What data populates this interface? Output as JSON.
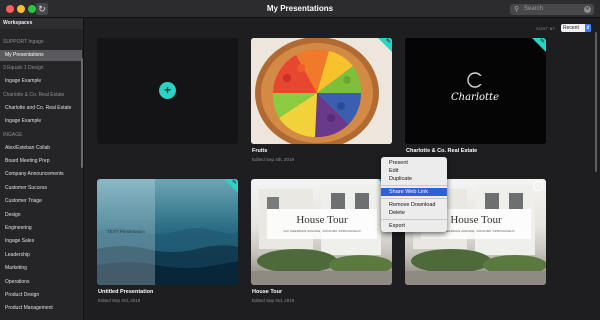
{
  "window": {
    "title": "My Presentations"
  },
  "search": {
    "placeholder": "Search"
  },
  "sidebar": {
    "header": "Workspaces",
    "rows": [
      {
        "type": "section",
        "label": "SUPPORT Ingage"
      },
      {
        "type": "item",
        "label": "My Presentations",
        "selected": true
      },
      {
        "type": "section",
        "label": "3 Equals 1 Design"
      },
      {
        "type": "item",
        "label": "Ingage Example"
      },
      {
        "type": "section",
        "label": "Charlotte & Co. Real Estate"
      },
      {
        "type": "item",
        "label": "Charlotte and Co. Real Estate"
      },
      {
        "type": "item",
        "label": "Ingage Example"
      },
      {
        "type": "section",
        "label": "INGAGE"
      },
      {
        "type": "item",
        "label": "Alex/Esteban Collab"
      },
      {
        "type": "item",
        "label": "Board Meeting Prep"
      },
      {
        "type": "item",
        "label": "Company Announcements"
      },
      {
        "type": "item",
        "label": "Customer Success"
      },
      {
        "type": "item",
        "label": "Customer Triage"
      },
      {
        "type": "item",
        "label": "Design"
      },
      {
        "type": "item",
        "label": "Engineering"
      },
      {
        "type": "item",
        "label": "Ingage Sales"
      },
      {
        "type": "item",
        "label": "Leadership"
      },
      {
        "type": "item",
        "label": "Marketing"
      },
      {
        "type": "item",
        "label": "Operations"
      },
      {
        "type": "item",
        "label": "Product Design"
      },
      {
        "type": "item",
        "label": "Product Management"
      }
    ]
  },
  "toolbar": {
    "sort_label": "SORT BY",
    "sort_value": "Recent"
  },
  "cards": {
    "new": {
      "add_icon": "plus-icon"
    },
    "fruits": {
      "title": "Fruits",
      "subtitle": "Edited Sep 4th, 2019"
    },
    "charlotte": {
      "title": "Charlotte & Co. Real Estate",
      "subtitle": "",
      "logo_letter": "C",
      "logo_text": "Charlotte"
    },
    "untitled": {
      "title": "Untitled Presentation",
      "subtitle": "Edited Sep 3rd, 2019",
      "thumb_text": "TEXT Presentation"
    },
    "housetour": {
      "title": "House Tour",
      "subtitle": "Edited Sep 3rd, 2019",
      "thumb_title": "House Tour",
      "thumb_sub": "123 SHERMAN AVENUE, DUNKIRK SPRINGFIELD"
    },
    "housetour2": {
      "thumb_title": "House Tour",
      "thumb_sub": "123 SHERMAN AVENUE, DUNKIRK SPRINGFIELD"
    }
  },
  "context_menu": {
    "items": [
      "Present",
      "Edit",
      "Duplicate",
      "Share Web Link",
      "Remove Download",
      "Delete",
      "Export"
    ]
  },
  "colors": {
    "accent": "#2bd3c4",
    "selection": "#2b62d9"
  }
}
